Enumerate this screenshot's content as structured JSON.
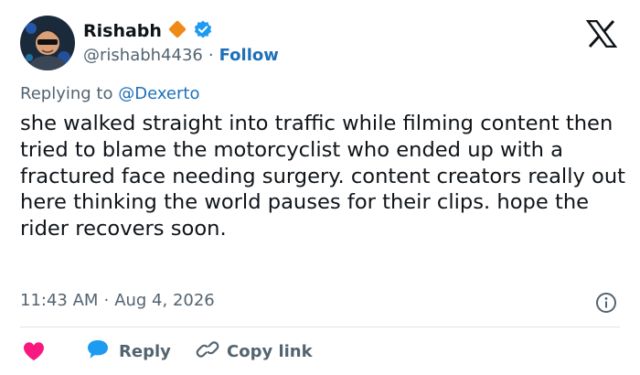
{
  "author": {
    "display_name": "Rishabh",
    "handle": "@rishabh4436",
    "separator": "·",
    "follow_label": "Follow"
  },
  "reply": {
    "prefix": "Replying to",
    "mention": "@Dexerto"
  },
  "post": {
    "text": "she walked straight into traffic while filming content then tried to blame the motorcyclist who ended up with a fractured face needing surgery. content creators really out here thinking the world pauses for their clips. hope the rider recovers soon.",
    "time": "11:43 AM",
    "separator": "·",
    "date": "Aug 4, 2026"
  },
  "actions": {
    "reply_label": "Reply",
    "copy_link_label": "Copy link"
  },
  "icons": {
    "gold_badge": "diamond-badge-icon",
    "verified": "verified-check-icon",
    "logo": "x-logo-icon",
    "info": "info-icon",
    "like": "heart-icon",
    "reply": "speech-bubble-icon",
    "copy": "link-icon"
  },
  "colors": {
    "text": "#0f1419",
    "secondary": "#536471",
    "link": "#1d70b8",
    "heart": "#f91880",
    "reply_bubble": "#1d9bf0",
    "gold_badge": "#f08a16",
    "verified": "#1d9bf0"
  }
}
